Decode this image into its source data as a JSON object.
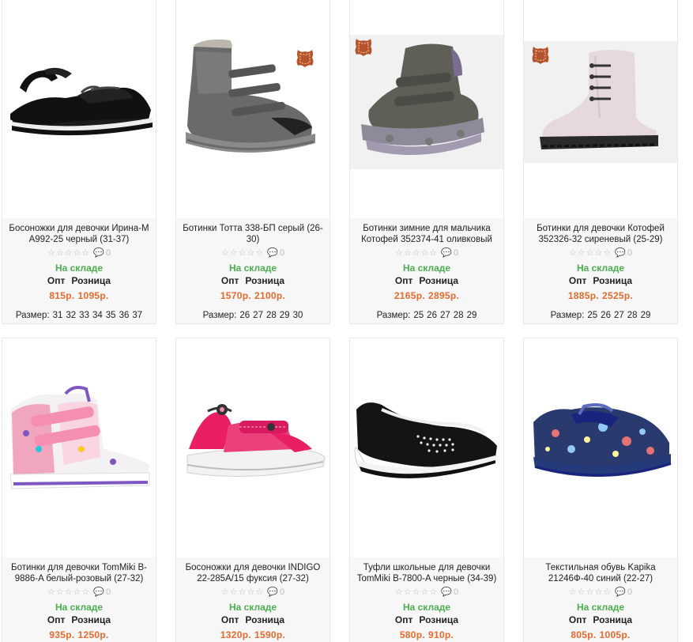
{
  "products": [
    {
      "title": "Босоножки для девочки Ирина-М A992-25 черный (31-37)",
      "rating_stars": "☆☆☆☆☆",
      "reviews": "0",
      "stock": "На складе",
      "opt_label": "Опт",
      "retail_label": "Розница",
      "opt_price": "815р.",
      "retail_price": "1095р.",
      "sizes_label": "Размер:",
      "sizes": [
        "31",
        "32",
        "33",
        "34",
        "35",
        "36",
        "37"
      ],
      "leather_badge": false,
      "icon": "black-sandal-image"
    },
    {
      "title": "Ботинки Тотта 338-БП серый (26-30)",
      "rating_stars": "☆☆☆☆☆",
      "reviews": "0",
      "stock": "На складе",
      "opt_label": "Опт",
      "retail_label": "Розница",
      "opt_price": "1570р.",
      "retail_price": "2100р.",
      "sizes_label": "Размер:",
      "sizes": [
        "26",
        "27",
        "28",
        "29",
        "30"
      ],
      "leather_badge": true,
      "icon": "grey-boot-image"
    },
    {
      "title": "Ботинки зимние для мальчика Котофей 352374-41 оливковый (25-",
      "rating_stars": "☆☆☆☆☆",
      "reviews": "0",
      "stock": "На складе",
      "opt_label": "Опт",
      "retail_label": "Розница",
      "opt_price": "2165р.",
      "retail_price": "2895р.",
      "sizes_label": "Размер:",
      "sizes": [
        "25",
        "26",
        "27",
        "28",
        "29"
      ],
      "leather_badge": true,
      "icon": "olive-winter-boot-image"
    },
    {
      "title": "Ботинки для девочки Котофей 352326-32 сиреневый (25-29)",
      "rating_stars": "☆☆☆☆☆",
      "reviews": "0",
      "stock": "На складе",
      "opt_label": "Опт",
      "retail_label": "Розница",
      "opt_price": "1885р.",
      "retail_price": "2525р.",
      "sizes_label": "Размер:",
      "sizes": [
        "25",
        "26",
        "27",
        "28",
        "29"
      ],
      "leather_badge": true,
      "icon": "lilac-boot-image"
    },
    {
      "title": "Ботинки для девочки TomMiki B-9886-A белый-розовый (27-32)",
      "rating_stars": "☆☆☆☆☆",
      "reviews": "0",
      "stock": "На складе",
      "opt_label": "Опт",
      "retail_label": "Розница",
      "opt_price": "935р.",
      "retail_price": "1250р.",
      "leather_badge": false,
      "icon": "pink-hightop-sneaker-image"
    },
    {
      "title": "Босоножки для девочки INDIGO 22-285A/15 фуксия (27-32)",
      "rating_stars": "☆☆☆☆☆",
      "reviews": "0",
      "stock": "На складе",
      "opt_label": "Опт",
      "retail_label": "Розница",
      "opt_price": "1320р.",
      "retail_price": "1590р.",
      "leather_badge": false,
      "icon": "fuchsia-sandal-image"
    },
    {
      "title": "Туфли школьные для девочки TomMiki B-7800-A черные (34-39)",
      "rating_stars": "☆☆☆☆☆",
      "reviews": "0",
      "stock": "На складе",
      "opt_label": "Опт",
      "retail_label": "Розница",
      "opt_price": "580р.",
      "retail_price": "910р.",
      "leather_badge": false,
      "icon": "black-school-shoe-image"
    },
    {
      "title": "Текстильная обувь Kapika 21246Ф-40 синий (22-27)",
      "rating_stars": "☆☆☆☆☆",
      "reviews": "0",
      "stock": "На складе",
      "opt_label": "Опт",
      "retail_label": "Розница",
      "opt_price": "805р.",
      "retail_price": "1005р.",
      "leather_badge": false,
      "icon": "blue-textile-shoe-image"
    }
  ],
  "colors": {
    "in_stock": "#4caf50",
    "price": "#e8692c",
    "leather_badge": "#b5532a",
    "card_border": "#e8e8e8",
    "info_bg": "#f7f7f7"
  }
}
